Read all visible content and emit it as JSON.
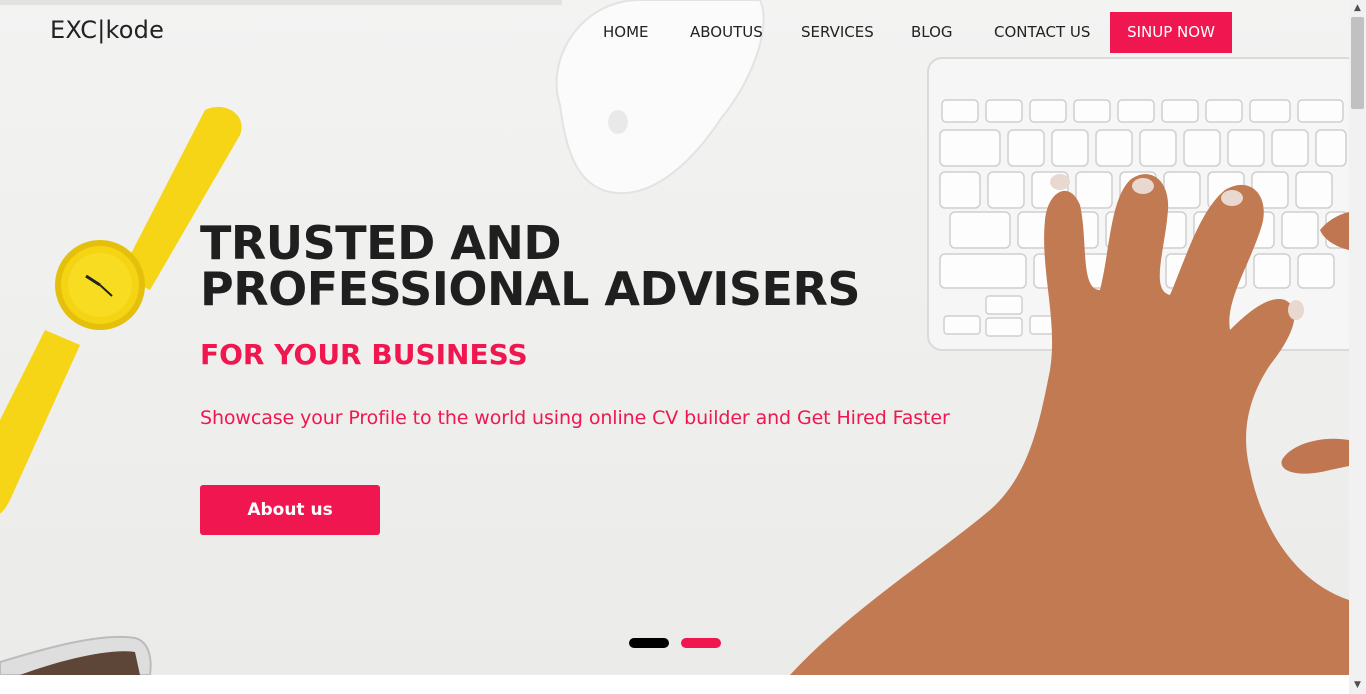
{
  "header": {
    "logo": "EXC|kode",
    "nav": {
      "home": "HOME",
      "about": "ABOUTUS",
      "services": "SERVICES",
      "blog": "BLOG",
      "contact": "CONTACT US",
      "cta": "SINUP NOW"
    }
  },
  "hero": {
    "headline_line1": "TRUSTED AND",
    "headline_line2": "PROFESSIONAL ADVISERS",
    "subheadline": "FOR YOUR BUSINESS",
    "tagline": "Showcase your Profile to the world using online CV builder and Get Hired Faster",
    "button": "About us"
  },
  "carousel": {
    "slides": 2,
    "active_index": 1
  },
  "colors": {
    "accent": "#f0164f",
    "text_dark": "#1f1f1f",
    "background": "#efefed"
  },
  "icons": {
    "scroll_up": "▲",
    "scroll_down": "▼"
  }
}
